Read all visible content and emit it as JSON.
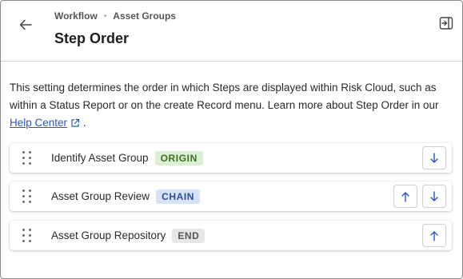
{
  "breadcrumb": {
    "items": [
      "Workflow",
      "Asset Groups"
    ]
  },
  "header": {
    "title": "Step Order"
  },
  "description": {
    "text": "This setting determines the order in which Steps are displayed within Risk Cloud, such as within a Status Report or on the create Record menu. Learn more about Step Order in our ",
    "link_text": "Help Center",
    "trailing": "."
  },
  "steps": [
    {
      "name": "Identify Asset Group",
      "badge": "ORIGIN",
      "badge_type": "origin",
      "can_move_up": false,
      "can_move_down": true
    },
    {
      "name": "Asset Group Review",
      "badge": "CHAIN",
      "badge_type": "chain",
      "can_move_up": true,
      "can_move_down": true
    },
    {
      "name": "Asset Group Repository",
      "badge": "END",
      "badge_type": "end",
      "can_move_up": true,
      "can_move_down": false
    }
  ],
  "colors": {
    "accent": "#2459c4",
    "origin_bg": "#dcefd2",
    "chain_bg": "#d5e2f7",
    "end_bg": "#e6e6e6"
  },
  "icons": {
    "back": "arrow-left-icon",
    "collapse": "collapse-panel-icon",
    "external": "external-link-icon",
    "drag": "drag-handle-icon",
    "up": "arrow-up-icon",
    "down": "arrow-down-icon"
  }
}
